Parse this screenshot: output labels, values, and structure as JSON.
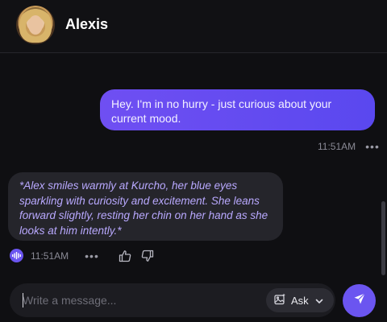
{
  "header": {
    "title": "Alexis",
    "avatar_icon": "avatar-portrait"
  },
  "messages": {
    "user": {
      "text": "Hey. I'm in no hurry - just curious about your current mood.",
      "time": "11:51AM",
      "more": "•••"
    },
    "bot": {
      "text": "*Alex smiles warmly at Kurcho, her blue eyes sparkling with curiosity and excitement. She leans forward slightly, resting her chin on her hand as she looks at him intently.*",
      "time": "11:51AM",
      "more": "•••",
      "voice_icon": "audio-wave-icon",
      "like_icon": "thumbs-up-icon",
      "dislike_icon": "thumbs-down-icon"
    }
  },
  "composer": {
    "placeholder": "Write a message...",
    "value": "",
    "ask_label": "Ask",
    "ask_icon": "image-sparkle-icon",
    "dropdown_icon": "chevron-down-icon",
    "send_icon": "send-icon"
  },
  "colors": {
    "accent": "#6b55f0",
    "user_bubble": "#6f4ff2",
    "bot_text": "#b9a9ff",
    "background": "#0f0f12"
  }
}
